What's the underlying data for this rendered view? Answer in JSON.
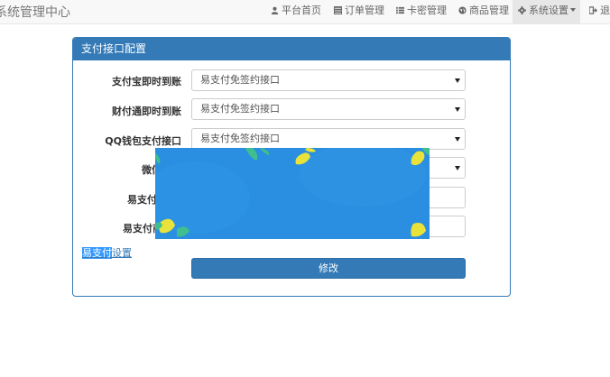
{
  "navbar": {
    "brand": "系统管理中心",
    "items": [
      {
        "icon": "user-icon",
        "label": "平台首页"
      },
      {
        "icon": "list-icon",
        "label": "订单管理"
      },
      {
        "icon": "list-icon",
        "label": "卡密管理"
      },
      {
        "icon": "globe-icon",
        "label": "商品管理"
      },
      {
        "icon": "gear-icon",
        "label": "系统设置"
      },
      {
        "icon": "logout-icon",
        "label": "退出"
      }
    ]
  },
  "panel": {
    "title": "支付接口配置",
    "rows": [
      {
        "label": "支付宝即时到账",
        "value": "易支付免签约接口"
      },
      {
        "label": "财付通即时到账",
        "value": "易支付免签约接口"
      },
      {
        "label": "QQ钱包支付接口",
        "value": "易支付免签约接口"
      },
      {
        "label": "微信支付"
      },
      {
        "label": "易支付商"
      },
      {
        "label": "易支付商户"
      }
    ],
    "link_highlight": "易支付",
    "link_rest": "设置",
    "submit_label": "修改"
  },
  "colors": {
    "primary": "#337ab7",
    "overlay_blue": "#2a8fe0",
    "leaf_yellow": "#e8e23a",
    "leaf_green": "#3fbf8f"
  }
}
